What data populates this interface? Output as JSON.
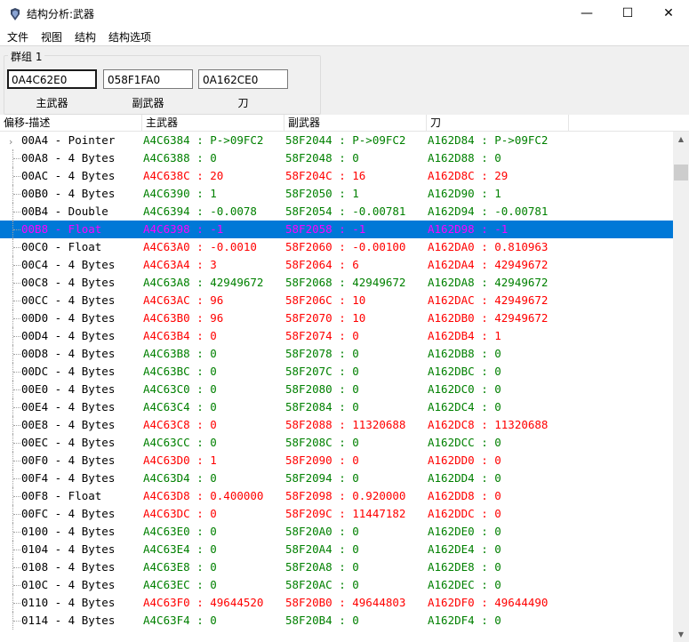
{
  "window": {
    "title": "结构分析:武器",
    "minimize": "—",
    "maximize": "☐",
    "close": "✕"
  },
  "menu": [
    "文件",
    "视图",
    "结构",
    "结构选项"
  ],
  "group": {
    "title": "群组 1",
    "addresses": [
      {
        "value": "0A4C62E0",
        "label": "主武器"
      },
      {
        "value": "058F1FA0",
        "label": "副武器"
      },
      {
        "value": "0A162CE0",
        "label": "刀"
      }
    ]
  },
  "columns": [
    "偏移-描述",
    "主武器",
    "副武器",
    "刀"
  ],
  "colors": {
    "equal": "#008000",
    "different": "#ff0000",
    "selected_bg": "#0078d7",
    "selected_text": "#ff00ff"
  },
  "rows": [
    {
      "desc": "00A4 - Pointer",
      "c1": "A4C6384 : P->09FC2",
      "c2": "58F2044 : P->09FC2",
      "c3": "A162D84 : P->09FC2",
      "color": "green",
      "expander": true
    },
    {
      "desc": "00A8 - 4 Bytes",
      "c1": "A4C6388 : 0",
      "c2": "58F2048 : 0",
      "c3": "A162D88 : 0",
      "color": "green"
    },
    {
      "desc": "00AC - 4 Bytes",
      "c1": "A4C638C : 20",
      "c2": "58F204C : 16",
      "c3": "A162D8C : 29",
      "color": "red"
    },
    {
      "desc": "00B0 - 4 Bytes",
      "c1": "A4C6390 : 1",
      "c2": "58F2050 : 1",
      "c3": "A162D90 : 1",
      "color": "green"
    },
    {
      "desc": "00B4 - Double",
      "c1": "A4C6394 : -0.0078",
      "c2": "58F2054 : -0.00781",
      "c3": "A162D94 : -0.00781",
      "color": "green"
    },
    {
      "desc": "00B8 - Float",
      "c1": "A4C6398 : -1",
      "c2": "58F2058 : -1",
      "c3": "A162D98 : -1",
      "color": "purple",
      "selected": true
    },
    {
      "desc": "00C0 - Float",
      "c1": "A4C63A0 : -0.0010",
      "c2": "58F2060 : -0.00100",
      "c3": "A162DA0 : 0.810963",
      "color": "red"
    },
    {
      "desc": "00C4 - 4 Bytes",
      "c1": "A4C63A4 : 3",
      "c2": "58F2064 : 6",
      "c3": "A162DA4 : 42949672",
      "color": "red"
    },
    {
      "desc": "00C8 - 4 Bytes",
      "c1": "A4C63A8 : 42949672",
      "c2": "58F2068 : 42949672",
      "c3": "A162DA8 : 42949672",
      "color": "green"
    },
    {
      "desc": "00CC - 4 Bytes",
      "c1": "A4C63AC : 96",
      "c2": "58F206C : 10",
      "c3": "A162DAC : 42949672",
      "color": "red"
    },
    {
      "desc": "00D0 - 4 Bytes",
      "c1": "A4C63B0 : 96",
      "c2": "58F2070 : 10",
      "c3": "A162DB0 : 42949672",
      "color": "red"
    },
    {
      "desc": "00D4 - 4 Bytes",
      "c1": "A4C63B4 : 0",
      "c2": "58F2074 : 0",
      "c3": "A162DB4 : 1",
      "color": "red"
    },
    {
      "desc": "00D8 - 4 Bytes",
      "c1": "A4C63B8 : 0",
      "c2": "58F2078 : 0",
      "c3": "A162DB8 : 0",
      "color": "green"
    },
    {
      "desc": "00DC - 4 Bytes",
      "c1": "A4C63BC : 0",
      "c2": "58F207C : 0",
      "c3": "A162DBC : 0",
      "color": "green"
    },
    {
      "desc": "00E0 - 4 Bytes",
      "c1": "A4C63C0 : 0",
      "c2": "58F2080 : 0",
      "c3": "A162DC0 : 0",
      "color": "green"
    },
    {
      "desc": "00E4 - 4 Bytes",
      "c1": "A4C63C4 : 0",
      "c2": "58F2084 : 0",
      "c3": "A162DC4 : 0",
      "color": "green"
    },
    {
      "desc": "00E8 - 4 Bytes",
      "c1": "A4C63C8 : 0",
      "c2": "58F2088 : 11320688",
      "c3": "A162DC8 : 11320688",
      "color": "red"
    },
    {
      "desc": "00EC - 4 Bytes",
      "c1": "A4C63CC : 0",
      "c2": "58F208C : 0",
      "c3": "A162DCC : 0",
      "color": "green"
    },
    {
      "desc": "00F0 - 4 Bytes",
      "c1": "A4C63D0 : 1",
      "c2": "58F2090 : 0",
      "c3": "A162DD0 : 0",
      "color": "red"
    },
    {
      "desc": "00F4 - 4 Bytes",
      "c1": "A4C63D4 : 0",
      "c2": "58F2094 : 0",
      "c3": "A162DD4 : 0",
      "color": "green"
    },
    {
      "desc": "00F8 - Float",
      "c1": "A4C63D8 : 0.400000",
      "c2": "58F2098 : 0.920000",
      "c3": "A162DD8 : 0",
      "color": "red"
    },
    {
      "desc": "00FC - 4 Bytes",
      "c1": "A4C63DC : 0",
      "c2": "58F209C : 11447182",
      "c3": "A162DDC : 0",
      "color": "red"
    },
    {
      "desc": "0100 - 4 Bytes",
      "c1": "A4C63E0 : 0",
      "c2": "58F20A0 : 0",
      "c3": "A162DE0 : 0",
      "color": "green"
    },
    {
      "desc": "0104 - 4 Bytes",
      "c1": "A4C63E4 : 0",
      "c2": "58F20A4 : 0",
      "c3": "A162DE4 : 0",
      "color": "green"
    },
    {
      "desc": "0108 - 4 Bytes",
      "c1": "A4C63E8 : 0",
      "c2": "58F20A8 : 0",
      "c3": "A162DE8 : 0",
      "color": "green"
    },
    {
      "desc": "010C - 4 Bytes",
      "c1": "A4C63EC : 0",
      "c2": "58F20AC : 0",
      "c3": "A162DEC : 0",
      "color": "green"
    },
    {
      "desc": "0110 - 4 Bytes",
      "c1": "A4C63F0 : 49644520",
      "c2": "58F20B0 : 49644803",
      "c3": "A162DF0 : 49644490",
      "color": "red"
    },
    {
      "desc": "0114 - 4 Bytes",
      "c1": "A4C63F4 : 0",
      "c2": "58F20B4 : 0",
      "c3": "A162DF4 : 0",
      "color": "green"
    }
  ]
}
